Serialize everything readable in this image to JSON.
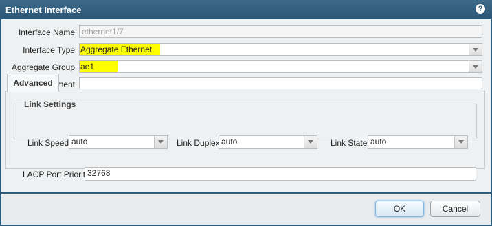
{
  "dialog": {
    "title": "Ethernet Interface",
    "help_icon": "?"
  },
  "fields": {
    "interface_name_label": "Interface Name",
    "interface_name_value": "ethernet1/7",
    "interface_type_label": "Interface Type",
    "interface_type_value": "Aggregate Ethernet",
    "aggregate_group_label": "Aggregate Group",
    "aggregate_group_value": "ae1",
    "comment_label": "Comment",
    "comment_value": ""
  },
  "tabs": [
    {
      "label": "Advanced"
    }
  ],
  "link_settings": {
    "legend": "Link Settings",
    "speed_label": "Link Speed",
    "speed_value": "auto",
    "duplex_label": "Link Duplex",
    "duplex_value": "auto",
    "state_label": "Link State",
    "state_value": "auto"
  },
  "lacp": {
    "priority_label": "LACP Port Priority",
    "priority_value": "32768"
  },
  "buttons": {
    "ok": "OK",
    "cancel": "Cancel"
  },
  "colors": {
    "titlebar": "#2f5b7a",
    "highlight": "#ffff00",
    "ok_glow": "#7fb6e2"
  }
}
